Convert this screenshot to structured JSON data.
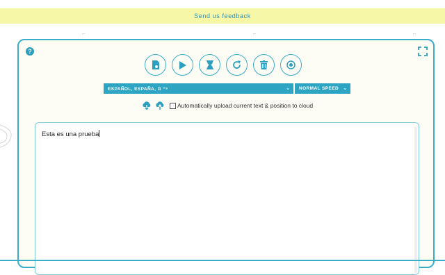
{
  "feedback": {
    "label": "Send us feedback"
  },
  "panel": {
    "help_icon": "?",
    "controls": [
      {
        "name": "voice-file-button",
        "icon": "file-audio-icon"
      },
      {
        "name": "play-button",
        "icon": "play-icon"
      },
      {
        "name": "timer-button",
        "icon": "hourglass-icon"
      },
      {
        "name": "reset-button",
        "icon": "refresh-icon"
      },
      {
        "name": "delete-button",
        "icon": "trash-icon"
      },
      {
        "name": "record-button",
        "icon": "record-icon"
      }
    ],
    "language_select": {
      "value": "ESPAÑOL, ESPAÑA, G ⁺⁸",
      "chevron": "⌄"
    },
    "speed_select": {
      "value": "NORMAL SPEED",
      "chevron": "⌄"
    },
    "upload_label": "Automatically upload current text & position to cloud",
    "editor_text": "Esta es una prueba"
  },
  "colors": {
    "accent": "#2da5c2",
    "feedback_bg": "#f7f7a8",
    "panel_bg": "#fdfcf5"
  }
}
